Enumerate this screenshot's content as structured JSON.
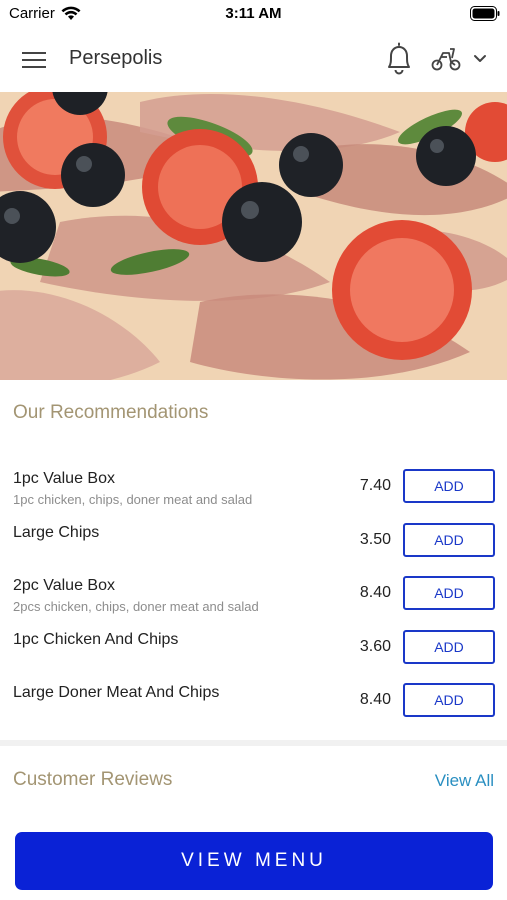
{
  "status_bar": {
    "carrier": "Carrier",
    "time": "3:11 AM"
  },
  "header": {
    "title": "Persepolis"
  },
  "recommendations": {
    "title": "Our Recommendations",
    "items": [
      {
        "name": "1pc Value Box",
        "description": "1pc chicken, chips, doner meat and salad",
        "price": "7.40",
        "button": "ADD"
      },
      {
        "name": "Large Chips",
        "description": "",
        "price": "3.50",
        "button": "ADD"
      },
      {
        "name": "2pc Value Box",
        "description": "2pcs chicken, chips, doner meat and salad",
        "price": "8.40",
        "button": "ADD"
      },
      {
        "name": "1pc Chicken And Chips",
        "description": "",
        "price": "3.60",
        "button": "ADD"
      },
      {
        "name": "Large Doner Meat And Chips",
        "description": "",
        "price": "8.40",
        "button": "ADD"
      }
    ]
  },
  "reviews": {
    "title": "Customer Reviews",
    "view_all": "View All"
  },
  "footer": {
    "view_menu": "VIEW MENU"
  },
  "colors": {
    "accent": "#0a22d6",
    "add_button": "#1a38c8",
    "section_title": "#a39573",
    "link": "#2a8fc1"
  },
  "icons": [
    "wifi-icon",
    "battery-icon",
    "menu-icon",
    "bell-icon",
    "scooter-icon",
    "chevron-down-icon"
  ]
}
